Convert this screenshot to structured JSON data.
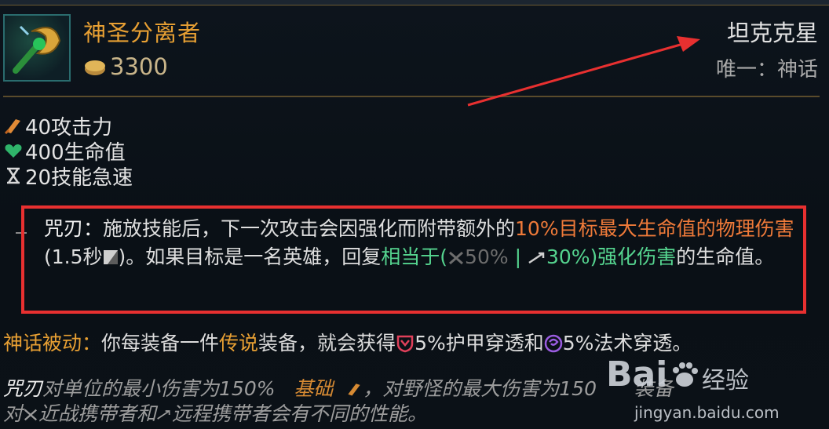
{
  "item": {
    "name": "神圣分离者",
    "cost": "3300",
    "class": "坦克克星",
    "unique": "唯一：神话",
    "icon": "divine-sunderer-icon"
  },
  "stats": [
    {
      "icon": "attack-damage-icon",
      "text": "40攻击力"
    },
    {
      "icon": "health-icon",
      "text": "400生命值"
    },
    {
      "icon": "ability-haste-icon",
      "text": "20技能急速"
    }
  ],
  "passive": {
    "name": "咒刃：",
    "text1": "施放技能后，下一次攻击会因强化而附带额外的",
    "highlight1": "10%目标最大生命值的物理伤害",
    "text2": "(1.5秒",
    "text3": ")。如果目标是一名英雄，回复",
    "heal_prefix": "相当于(",
    "melee_value": "50%",
    "separator": " | ",
    "ranged_value": "30%",
    "heal_suffix": ")强化伤害",
    "text4": "的生命值。"
  },
  "mythic": {
    "label": "神话被动：",
    "text1": "你每装备一件",
    "legend": "传说",
    "text2": "装备，就会获得",
    "armor_pen": "5%护甲穿透",
    "text3": "和",
    "magic_pen": "5%法术穿透。"
  },
  "note": {
    "strong": "咒刃",
    "line1_text": "对单位的最小伤害为150%",
    "line1_base": "基础",
    "line1_rest": "，对野怪的最大伤害为150",
    "line1_end": "装备",
    "line2_prefix": "对",
    "line2_melee": "近战携带者和",
    "line2_ranged": "远程携带者会有不同的性能。"
  },
  "watermark": {
    "logo": "Bai",
    "logo2": "经验",
    "url": "jingyan.baidu.com"
  },
  "colors": {
    "item_name": "#e8a033",
    "orange_text": "#ef7a39",
    "green_text": "#55d48f",
    "annotation_red": "#e83030"
  }
}
